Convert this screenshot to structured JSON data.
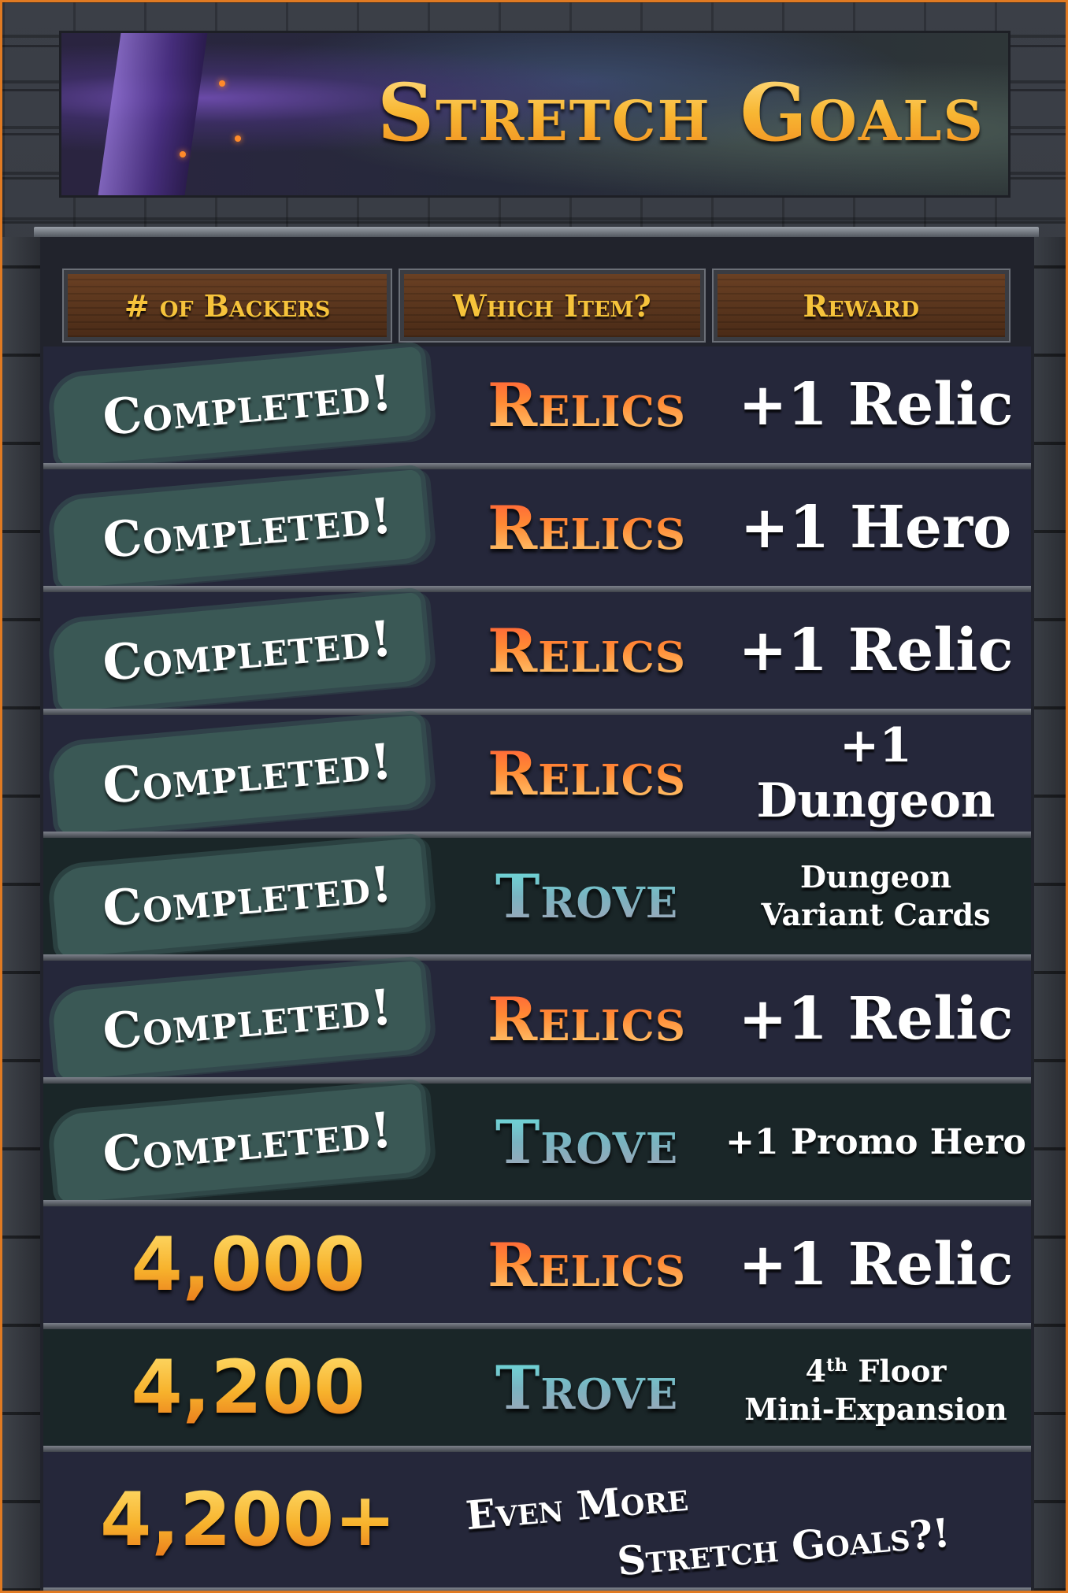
{
  "title": "Stretch Goals",
  "headers": {
    "backers": "# of Backers",
    "item": "Which Item?",
    "reward": "Reward"
  },
  "rows": [
    {
      "goal": "Completed!",
      "item": "Relics",
      "reward": "+1 Relic"
    },
    {
      "goal": "Completed!",
      "item": "Relics",
      "reward": "+1 Hero"
    },
    {
      "goal": "Completed!",
      "item": "Relics",
      "reward": "+1 Relic"
    },
    {
      "goal": "Completed!",
      "item": "Relics",
      "reward": "+1 Dungeon"
    },
    {
      "goal": "Completed!",
      "item": "Trove",
      "reward_line1": "Dungeon",
      "reward_line2": "Variant Cards"
    },
    {
      "goal": "Completed!",
      "item": "Relics",
      "reward": "+1 Relic"
    },
    {
      "goal": "Completed!",
      "item": "Trove",
      "reward": "+1 Promo Hero"
    },
    {
      "goal": "4,000",
      "item": "Relics",
      "reward": "+1 Relic"
    },
    {
      "goal": "4,200",
      "item": "Trove",
      "reward_line1_num": "4",
      "reward_line1_sup": "th",
      "reward_line1_rest": " Floor",
      "reward_line2": "Mini-Expansion"
    },
    {
      "goal": "4,200+",
      "more_line1": "Even More",
      "more_line2": "Stretch Goals?!"
    }
  ],
  "colors": {
    "accent_orange": "#e07a22",
    "relics_gradient": [
      "#ff5a3a",
      "#ffd27a"
    ],
    "trove_gradient": [
      "#68e2df",
      "#a7a3b6"
    ],
    "stamp": "#3a5855"
  }
}
